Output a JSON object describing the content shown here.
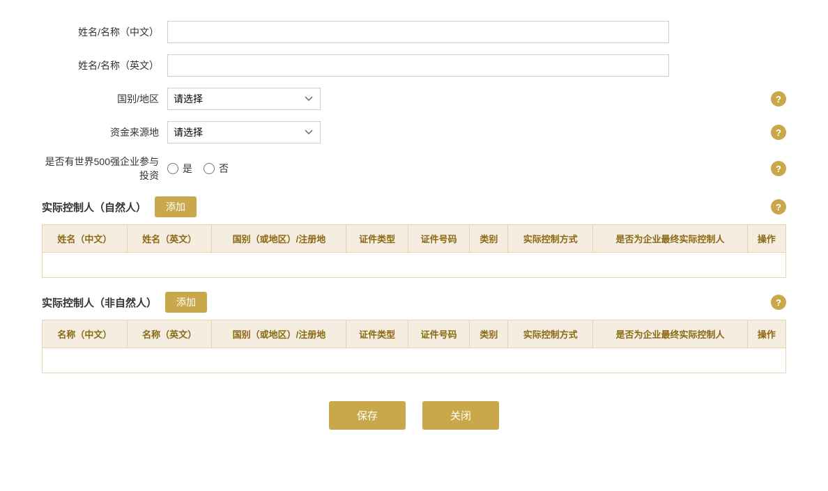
{
  "form": {
    "name_chinese_label": "姓名/名称（中文）",
    "name_english_label": "姓名/名称（英文）",
    "country_label": "国别/地区",
    "funding_source_label": "资金来源地",
    "fortune500_label": "是否有世界500强企业参与投资",
    "yes_label": "是",
    "no_label": "否",
    "select_placeholder": "请选择",
    "name_chinese_value": "",
    "name_english_value": ""
  },
  "natural_person_section": {
    "title": "实际控制人（自然人）",
    "add_label": "添加",
    "help_icon": "?",
    "columns": [
      "姓名（中文）",
      "姓名（英文）",
      "国别（或地区）/注册地",
      "证件类型",
      "证件号码",
      "类别",
      "实际控制方式",
      "是否为企业最终实际控制人",
      "操作"
    ]
  },
  "non_natural_person_section": {
    "title": "实际控制人（非自然人）",
    "add_label": "添加",
    "help_icon": "?",
    "columns": [
      "名称（中文）",
      "名称（英文）",
      "国别（或地区）/注册地",
      "证件类型",
      "证件号码",
      "类别",
      "实际控制方式",
      "是否为企业最终实际控制人",
      "操作"
    ]
  },
  "footer": {
    "save_label": "保存",
    "close_label": "关闭"
  },
  "help_icon_symbol": "?"
}
